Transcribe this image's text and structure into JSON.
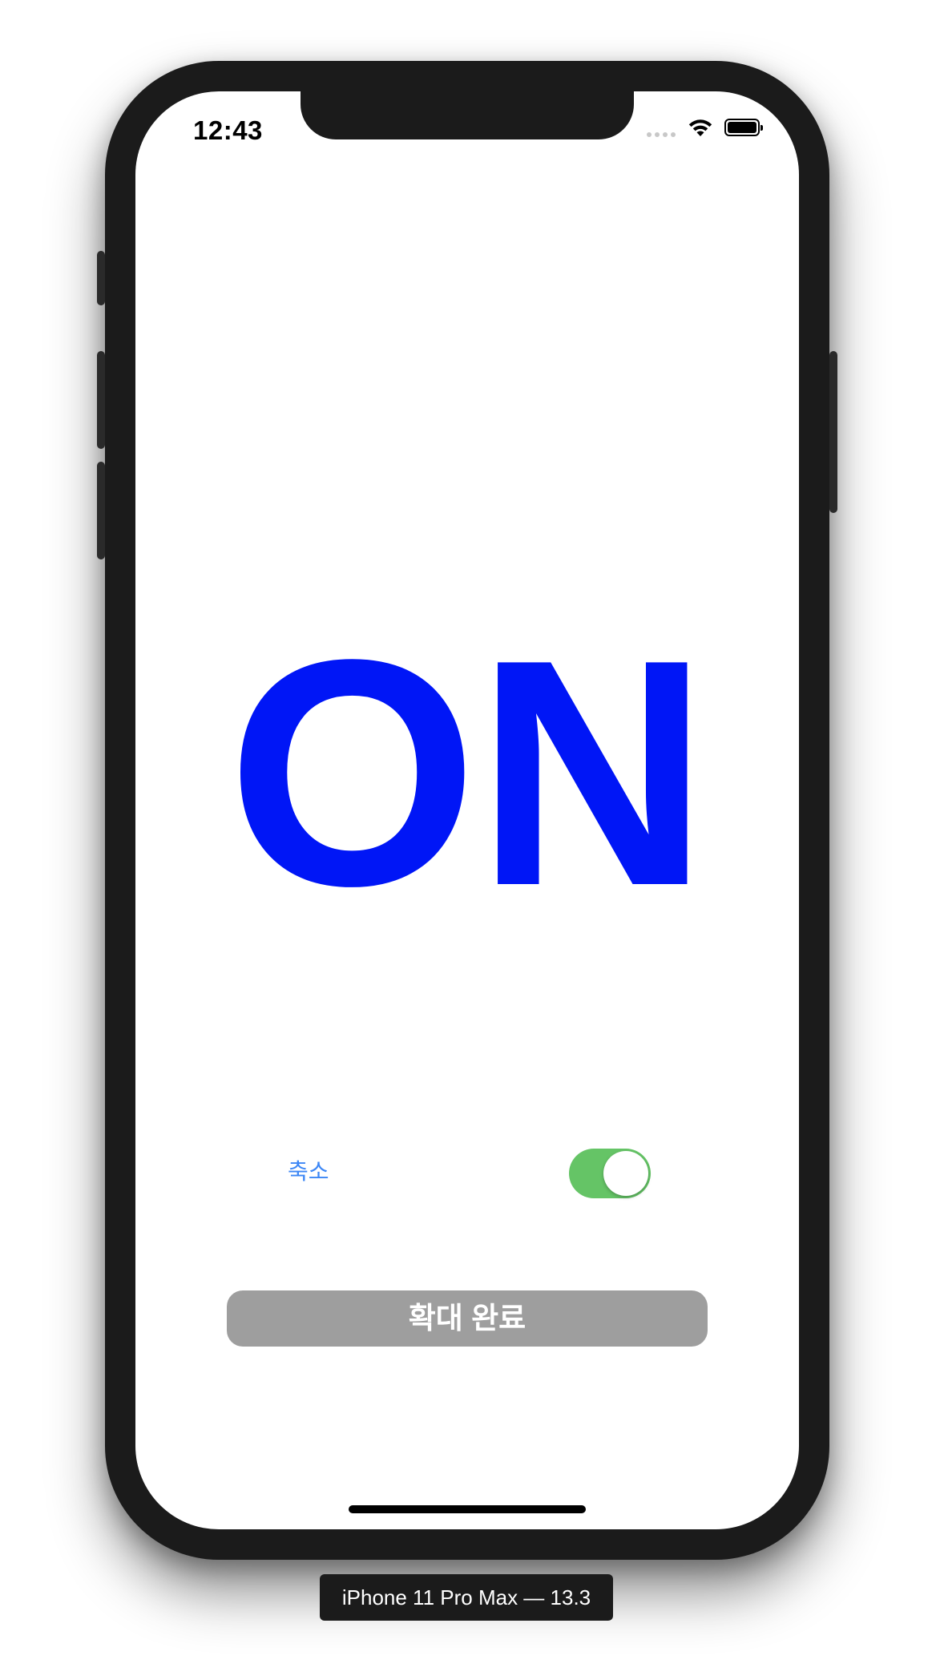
{
  "status_bar": {
    "time": "12:43",
    "icons": [
      "cellular-signal-icon",
      "wifi-icon",
      "battery-icon"
    ]
  },
  "main": {
    "state_label": "ON",
    "state_label_color": "#0016f6",
    "shrink_button_label": "축소",
    "toggle": {
      "on": true,
      "on_color": "#65c466"
    },
    "done_button_label": "확대 완료",
    "done_button_color": "#9e9e9e"
  },
  "simulator": {
    "device_label": "iPhone 11 Pro Max — 13.3"
  }
}
